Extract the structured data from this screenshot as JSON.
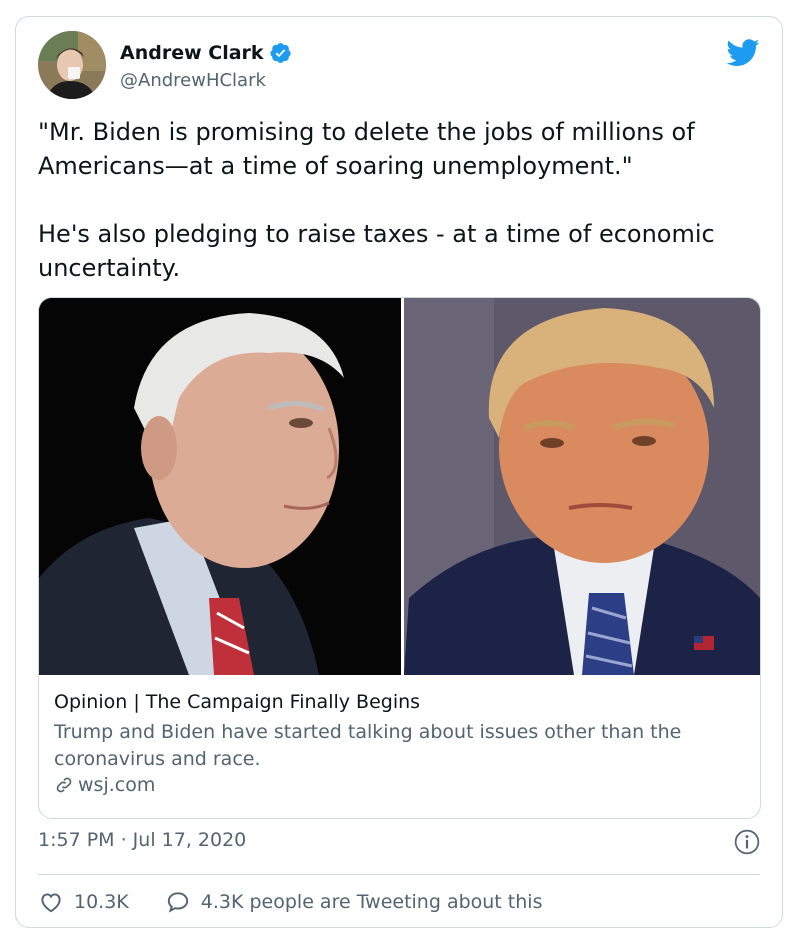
{
  "author": {
    "name": "Andrew Clark",
    "handle": "@AndrewHClark"
  },
  "tweet": {
    "text": "\"Mr. Biden is promising to delete the jobs of millions of Americans—at a time of soaring unemployment.\"\n\nHe's also pledging to raise taxes - at a time of economic uncertainty."
  },
  "link_card": {
    "title": "Opinion | The Campaign Finally Begins",
    "description": "Trump and Biden have started talking about issues other than the coronavirus and race.",
    "domain": "wsj.com"
  },
  "meta": {
    "timestamp": "1:57 PM · Jul 17, 2020"
  },
  "actions": {
    "likes": "10.3K",
    "tweeting": "4.3K people are Tweeting about this"
  },
  "colors": {
    "twitter_blue": "#1d9bf0",
    "secondary_text": "#536471",
    "border": "#cfd9de"
  },
  "icons": [
    "verified-badge-icon",
    "twitter-bird-icon",
    "link-icon",
    "info-icon",
    "heart-icon",
    "speech-bubble-icon"
  ]
}
